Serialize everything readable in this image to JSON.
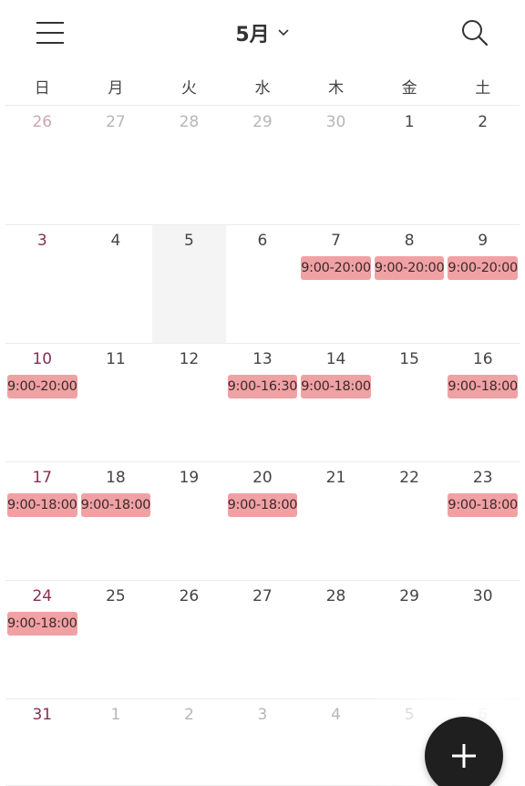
{
  "header": {
    "month_label": "5月",
    "icons": {
      "menu": "hamburger-menu-icon",
      "dropdown": "chevron-down-icon",
      "search": "search-icon"
    }
  },
  "weekdays": [
    "日",
    "月",
    "火",
    "水",
    "木",
    "金",
    "土"
  ],
  "colors": {
    "event_bg": "#f0a1a4",
    "sunday_text": "#8a2d52",
    "today_bg": "#f4f4f4",
    "fab_bg": "#1f1f1f"
  },
  "weeks": [
    [
      {
        "day": "26",
        "other": true,
        "events": []
      },
      {
        "day": "27",
        "other": true,
        "events": []
      },
      {
        "day": "28",
        "other": true,
        "events": []
      },
      {
        "day": "29",
        "other": true,
        "events": []
      },
      {
        "day": "30",
        "other": true,
        "events": []
      },
      {
        "day": "1",
        "other": false,
        "events": []
      },
      {
        "day": "2",
        "other": false,
        "events": []
      }
    ],
    [
      {
        "day": "3",
        "other": false,
        "events": []
      },
      {
        "day": "4",
        "other": false,
        "events": []
      },
      {
        "day": "5",
        "other": false,
        "today": true,
        "events": []
      },
      {
        "day": "6",
        "other": false,
        "events": []
      },
      {
        "day": "7",
        "other": false,
        "events": [
          "9:00-20:00"
        ]
      },
      {
        "day": "8",
        "other": false,
        "events": [
          "9:00-20:00"
        ]
      },
      {
        "day": "9",
        "other": false,
        "events": [
          "9:00-20:00"
        ]
      }
    ],
    [
      {
        "day": "10",
        "other": false,
        "events": [
          "9:00-20:00"
        ]
      },
      {
        "day": "11",
        "other": false,
        "events": []
      },
      {
        "day": "12",
        "other": false,
        "events": []
      },
      {
        "day": "13",
        "other": false,
        "events": [
          "9:00-16:30"
        ]
      },
      {
        "day": "14",
        "other": false,
        "events": [
          "9:00-18:00"
        ]
      },
      {
        "day": "15",
        "other": false,
        "events": []
      },
      {
        "day": "16",
        "other": false,
        "events": [
          "9:00-18:00"
        ]
      }
    ],
    [
      {
        "day": "17",
        "other": false,
        "events": [
          "9:00-18:00"
        ]
      },
      {
        "day": "18",
        "other": false,
        "events": [
          "9:00-18:00"
        ]
      },
      {
        "day": "19",
        "other": false,
        "events": []
      },
      {
        "day": "20",
        "other": false,
        "events": [
          "9:00-18:00"
        ]
      },
      {
        "day": "21",
        "other": false,
        "events": []
      },
      {
        "day": "22",
        "other": false,
        "events": []
      },
      {
        "day": "23",
        "other": false,
        "events": [
          "9:00-18:00"
        ]
      }
    ],
    [
      {
        "day": "24",
        "other": false,
        "events": [
          "9:00-18:00"
        ]
      },
      {
        "day": "25",
        "other": false,
        "events": []
      },
      {
        "day": "26",
        "other": false,
        "events": []
      },
      {
        "day": "27",
        "other": false,
        "events": []
      },
      {
        "day": "28",
        "other": false,
        "events": []
      },
      {
        "day": "29",
        "other": false,
        "events": []
      },
      {
        "day": "30",
        "other": false,
        "events": []
      }
    ],
    [
      {
        "day": "31",
        "other": false,
        "events": []
      },
      {
        "day": "1",
        "other": true,
        "events": []
      },
      {
        "day": "2",
        "other": true,
        "events": []
      },
      {
        "day": "3",
        "other": true,
        "events": []
      },
      {
        "day": "4",
        "other": true,
        "events": []
      },
      {
        "day": "5",
        "other": true,
        "events": []
      },
      {
        "day": "6",
        "other": true,
        "events": []
      }
    ]
  ],
  "fab": {
    "icon": "plus-icon"
  }
}
